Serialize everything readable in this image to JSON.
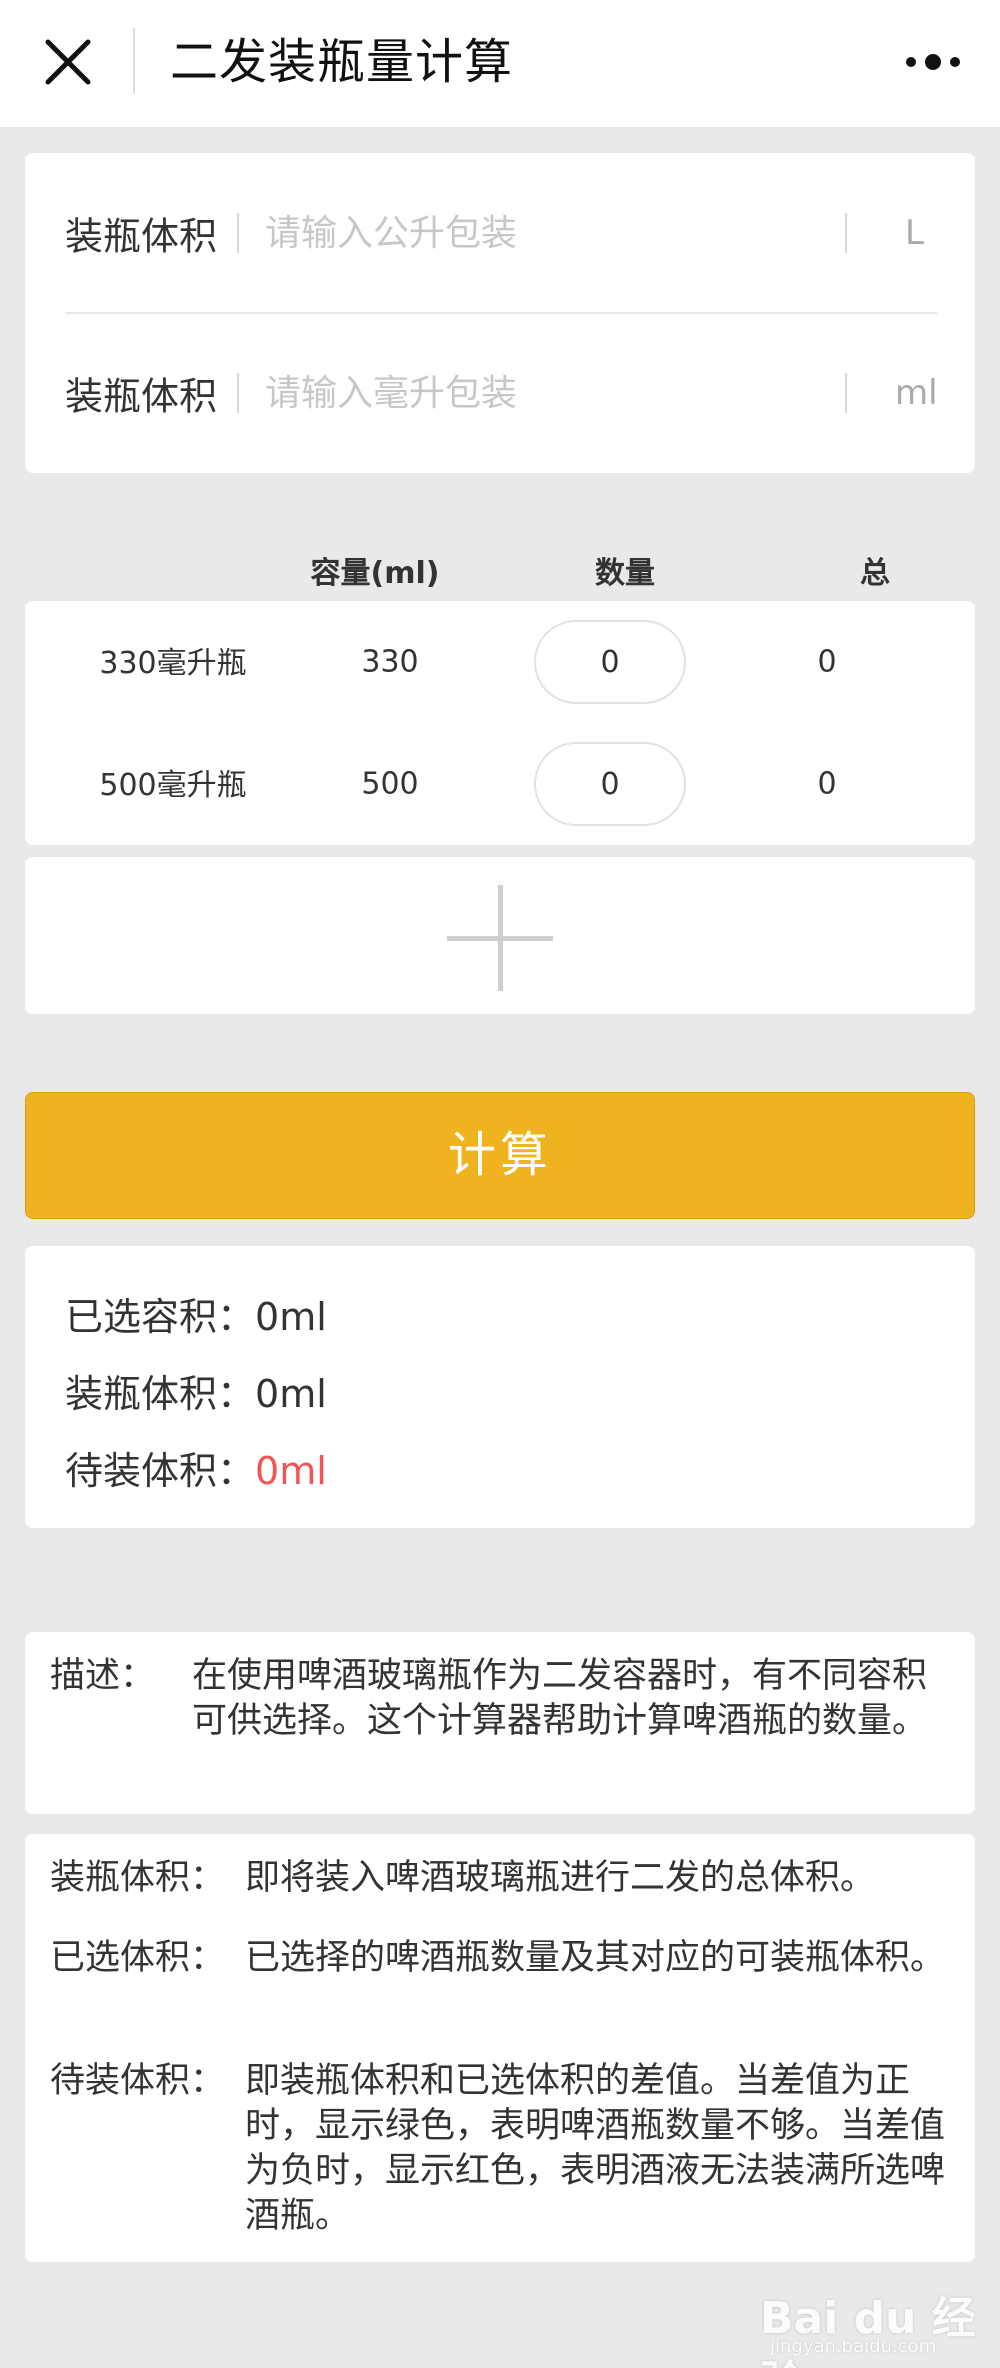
{
  "header": {
    "title": "二发装瓶量计算"
  },
  "inputs": [
    {
      "label": "装瓶体积",
      "placeholder": "请输入公升包装",
      "unit": "L"
    },
    {
      "label": "装瓶体积",
      "placeholder": "请输入毫升包装",
      "unit": "ml"
    }
  ],
  "table": {
    "headers": [
      "容量(ml)",
      "数量",
      "总"
    ],
    "rows": [
      {
        "name": "330毫升瓶",
        "capacity": "330",
        "quantity": "0",
        "total": "0"
      },
      {
        "name": "500毫升瓶",
        "capacity": "500",
        "quantity": "0",
        "total": "0"
      }
    ]
  },
  "calc_button": {
    "label": "计算"
  },
  "results": [
    {
      "label": "已选容积：",
      "value": "0ml"
    },
    {
      "label": "装瓶体积：",
      "value": "0ml"
    },
    {
      "label": "待装体积：",
      "value": "0ml"
    }
  ],
  "description": {
    "key": "描述：",
    "text": "在使用啤酒玻璃瓶作为二发容器时，有不同容积可供选择。这个计算器帮助计算啤酒瓶的数量。"
  },
  "definitions": [
    {
      "key": "装瓶体积：",
      "text": "即将装入啤酒玻璃瓶进行二发的总体积。"
    },
    {
      "key": "已选体积：",
      "text": "已选择的啤酒瓶数量及其对应的可装瓶体积。"
    },
    {
      "key": "待装体积：",
      "text": "即装瓶体积和已选体积的差值。当差值为正时，显示绿色，表明啤酒瓶数量不够。当差值为负时，显示红色，表明酒液无法装满所选啤酒瓶。"
    }
  ],
  "watermark": {
    "text": "Bai du 经验",
    "sub": "jingyan.baidu.com"
  },
  "colors": {
    "accent": "#efb31f",
    "negative": "#f05454",
    "background": "#e9e9e9"
  }
}
